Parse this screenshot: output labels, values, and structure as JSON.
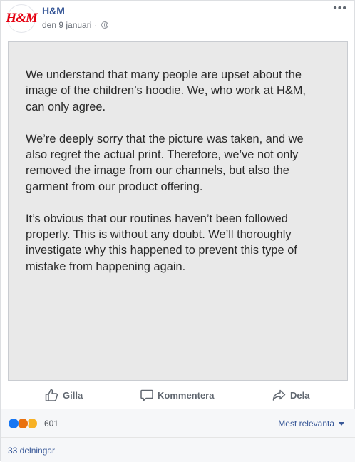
{
  "post": {
    "page_name": "H&M",
    "logo_text": "H&M",
    "date": "den 9 januari",
    "separator": "·",
    "more_label": "•••"
  },
  "statement": {
    "paragraphs": [
      "We understand that many people are upset about the image of the children’s hoodie. We, who work at H&M, can only agree.",
      "We’re deeply sorry that the picture was taken, and we also regret the actual print. Therefore, we’ve not only removed the image from our channels, but also the garment from our product offering.",
      "It’s obvious that our routines haven’t been followed properly. This is without any doubt. We’ll thoroughly investigate why this happened to prevent this type of mistake from happening again."
    ]
  },
  "actions": {
    "like": "Gilla",
    "comment": "Kommentera",
    "share": "Dela"
  },
  "reactions": {
    "icons": [
      "like-icon",
      "angry-icon",
      "haha-icon"
    ],
    "count": "601",
    "sort_label": "Mest relevanta"
  },
  "shares": {
    "label": "33 delningar"
  },
  "colors": {
    "link": "#385898",
    "like_blue": "#1877f2",
    "angry_orange": "#e9710f",
    "haha_yellow": "#f7b125",
    "hm_red": "#e50010"
  }
}
